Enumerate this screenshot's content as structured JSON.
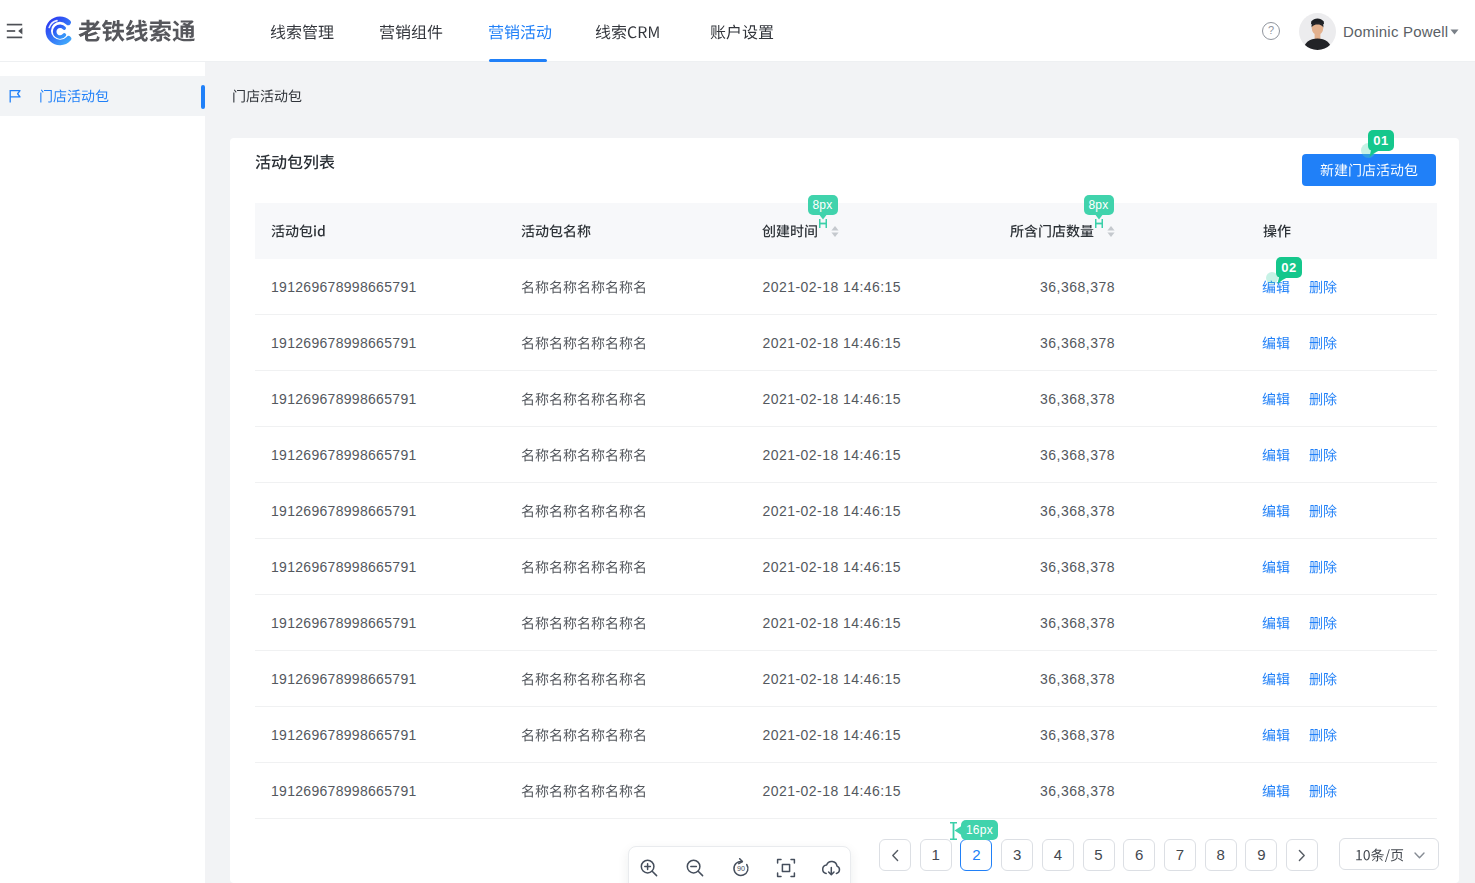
{
  "header": {
    "collapse_icon": "menu-fold",
    "logo_text": "老铁线索通",
    "nav": [
      {
        "label": "线索管理",
        "active": false
      },
      {
        "label": "营销组件",
        "active": false
      },
      {
        "label": "营销活动",
        "active": true
      },
      {
        "label": "线索CRM",
        "active": false
      },
      {
        "label": "账户设置",
        "active": false
      }
    ],
    "help_icon": "question-circle",
    "user": {
      "name": "Dominic Powell",
      "avatar": "user-photo",
      "dropdown_icon": "caret-down"
    }
  },
  "sidebar": {
    "items": [
      {
        "icon": "flag",
        "label": "门店活动包",
        "active": true
      }
    ]
  },
  "breadcrumb": "门店活动包",
  "panel": {
    "title": "活动包列表",
    "create_button": "新建门店活动包"
  },
  "table": {
    "columns": [
      {
        "key": "id",
        "label": "活动包id",
        "sortable": false
      },
      {
        "key": "name",
        "label": "活动包名称",
        "sortable": false
      },
      {
        "key": "created_at",
        "label": "创建时间",
        "sortable": true,
        "sort_icon": "caret-up-down"
      },
      {
        "key": "store_count",
        "label": "所含门店数量",
        "sortable": true,
        "sort_icon": "caret-up-down"
      },
      {
        "key": "actions",
        "label": "操作",
        "sortable": false
      }
    ],
    "rows": [
      {
        "id": "191269678998665791",
        "name": "名称名称名称名称名",
        "created_at": "2021-02-18 14:46:15",
        "store_count": "36,368,378",
        "actions": [
          "编辑",
          "删除"
        ]
      },
      {
        "id": "191269678998665791",
        "name": "名称名称名称名称名",
        "created_at": "2021-02-18 14:46:15",
        "store_count": "36,368,378",
        "actions": [
          "编辑",
          "删除"
        ]
      },
      {
        "id": "191269678998665791",
        "name": "名称名称名称名称名",
        "created_at": "2021-02-18 14:46:15",
        "store_count": "36,368,378",
        "actions": [
          "编辑",
          "删除"
        ]
      },
      {
        "id": "191269678998665791",
        "name": "名称名称名称名称名",
        "created_at": "2021-02-18 14:46:15",
        "store_count": "36,368,378",
        "actions": [
          "编辑",
          "删除"
        ]
      },
      {
        "id": "191269678998665791",
        "name": "名称名称名称名称名",
        "created_at": "2021-02-18 14:46:15",
        "store_count": "36,368,378",
        "actions": [
          "编辑",
          "删除"
        ]
      },
      {
        "id": "191269678998665791",
        "name": "名称名称名称名称名",
        "created_at": "2021-02-18 14:46:15",
        "store_count": "36,368,378",
        "actions": [
          "编辑",
          "删除"
        ]
      },
      {
        "id": "191269678998665791",
        "name": "名称名称名称名称名",
        "created_at": "2021-02-18 14:46:15",
        "store_count": "36,368,378",
        "actions": [
          "编辑",
          "删除"
        ]
      },
      {
        "id": "191269678998665791",
        "name": "名称名称名称名称名",
        "created_at": "2021-02-18 14:46:15",
        "store_count": "36,368,378",
        "actions": [
          "编辑",
          "删除"
        ]
      },
      {
        "id": "191269678998665791",
        "name": "名称名称名称名称名",
        "created_at": "2021-02-18 14:46:15",
        "store_count": "36,368,378",
        "actions": [
          "编辑",
          "删除"
        ]
      },
      {
        "id": "191269678998665791",
        "name": "名称名称名称名称名",
        "created_at": "2021-02-18 14:46:15",
        "store_count": "36,368,378",
        "actions": [
          "编辑",
          "删除"
        ]
      }
    ]
  },
  "pagination": {
    "prev_icon": "chevron-left",
    "pages": [
      "1",
      "2",
      "3",
      "4",
      "5",
      "6",
      "7",
      "8",
      "9"
    ],
    "active_page": "2",
    "next_icon": "chevron-right",
    "page_size": "10条/页"
  },
  "viewer_toolbar": {
    "icons": [
      "zoom-in",
      "zoom-out",
      "rotate-90",
      "fit-screen",
      "cloud-download"
    ]
  },
  "annotations": {
    "badges": [
      {
        "label": "01"
      },
      {
        "label": "02"
      }
    ],
    "measurements": [
      {
        "label": "8px"
      },
      {
        "label": "8px"
      },
      {
        "label": "16px"
      }
    ],
    "badge_color": "#15c78c",
    "measure_color": "#40d3ac"
  },
  "colors": {
    "accent": "#2080f8",
    "content_background": "#f2f3f5",
    "table_header_background": "#f7f8fa"
  }
}
